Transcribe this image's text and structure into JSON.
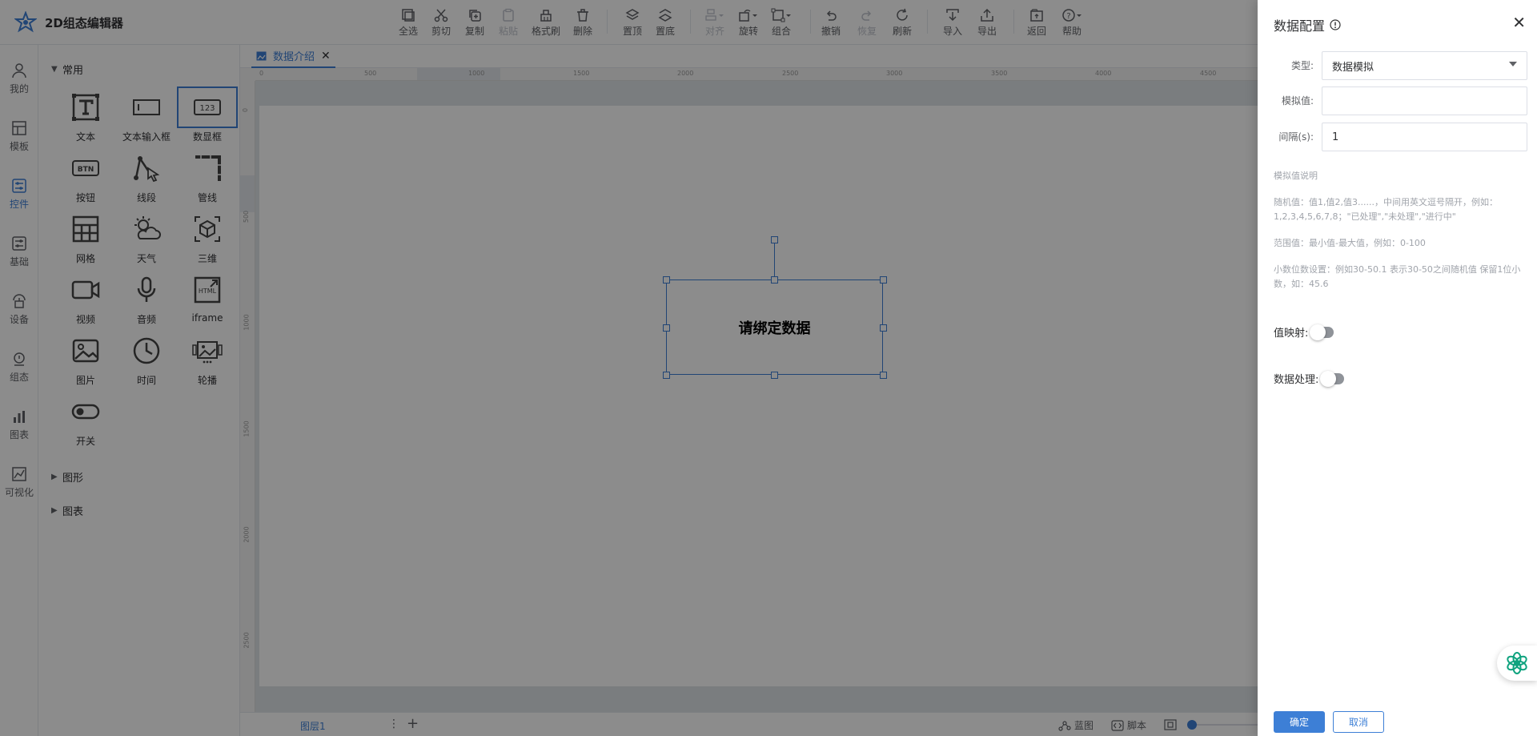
{
  "app": {
    "title": "2D组态编辑器"
  },
  "toolbar": {
    "select_all": "全选",
    "cut": "剪切",
    "copy": "复制",
    "paste": "粘贴",
    "format_brush": "格式刷",
    "delete": "删除",
    "bring_top": "置顶",
    "send_bottom": "置底",
    "align": "对齐",
    "rotate": "旋转",
    "group": "组合",
    "undo": "撤销",
    "redo": "恢复",
    "refresh": "刷新",
    "import": "导入",
    "export": "导出",
    "back": "返回",
    "help": "帮助"
  },
  "rail": [
    {
      "label": "我的"
    },
    {
      "label": "模板"
    },
    {
      "label": "控件"
    },
    {
      "label": "基础"
    },
    {
      "label": "设备"
    },
    {
      "label": "组态"
    },
    {
      "label": "图表"
    },
    {
      "label": "可视化"
    }
  ],
  "panel": {
    "group_common": "常用",
    "components": [
      "文本",
      "文本输入框",
      "数显框",
      "按钮",
      "线段",
      "管线",
      "网格",
      "天气",
      "三维",
      "视频",
      "音频",
      "iframe",
      "图片",
      "时间",
      "轮播",
      "开关"
    ],
    "group_shapes": "图形",
    "group_charts": "图表"
  },
  "tab": {
    "label": "数据介绍"
  },
  "ruler": {
    "h": [
      "0",
      "500",
      "1000",
      "1500",
      "2000",
      "2500",
      "3000",
      "3500",
      "4000",
      "4500"
    ],
    "v": [
      "0",
      "500",
      "1000",
      "1500",
      "2000",
      "2500"
    ]
  },
  "canvas": {
    "element_text": "请绑定数据"
  },
  "bottom": {
    "layer": "图层1",
    "blueprint": "蓝图",
    "script": "脚本"
  },
  "drawer": {
    "title": "数据配置",
    "type_label": "类型:",
    "type_value": "数据模拟",
    "sim_label": "模拟值:",
    "sim_value": "",
    "interval_label": "间隔(s):",
    "interval_value": "1",
    "desc_title": "模拟值说明",
    "desc_random": "随机值：值1,值2,值3......，中间用英文逗号隔开，例如：1,2,3,4,5,6,7,8；\"已处理\",\"未处理\",\"进行中\"",
    "desc_range": "范围值：最小值-最大值，例如：0-100",
    "desc_decimal": "小数位数设置：例如30-50.1 表示30-50之间随机值 保留1位小数，如：45.6",
    "value_map_label": "值映射:",
    "value_map_on": false,
    "data_proc_label": "数据处理:",
    "data_proc_on": false,
    "confirm": "确定",
    "cancel": "取消"
  },
  "colors": {
    "accent": "#3d7fd6",
    "mask": "rgba(0,0,0,0.45)"
  }
}
